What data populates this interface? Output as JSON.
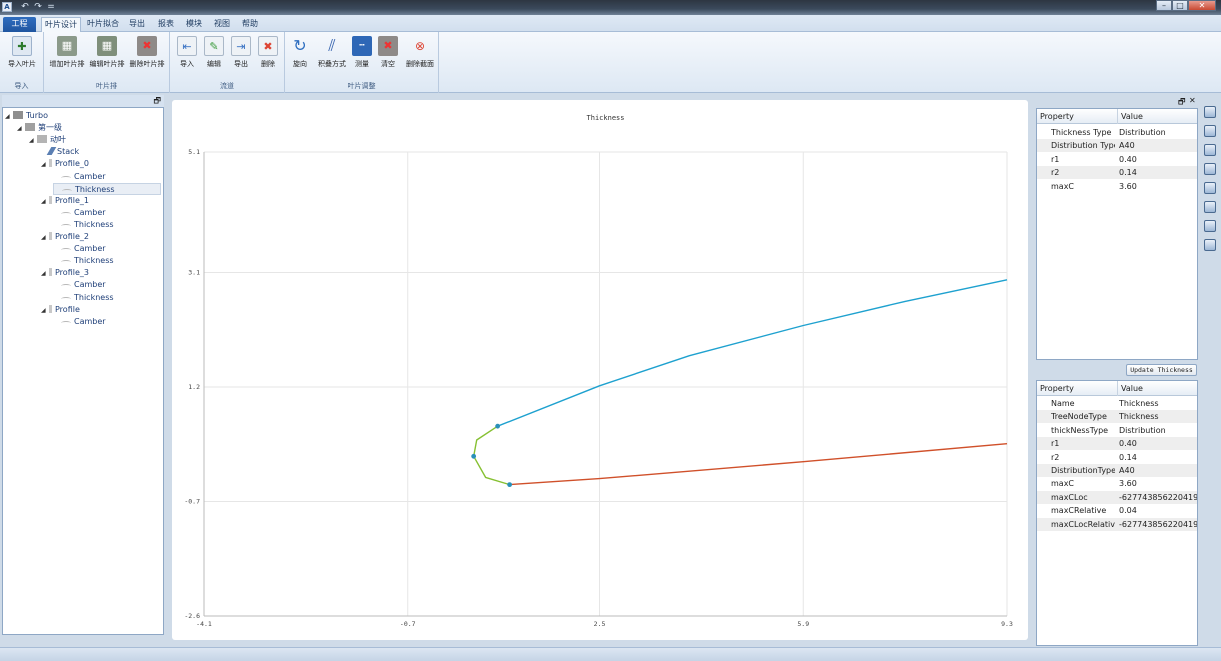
{
  "title_bar": {
    "app_icon": "A",
    "undo_icon": "↶",
    "redo_icon": "↷",
    "more_icon": "=",
    "min_icon": "–",
    "max_icon": "□",
    "close_icon": "✕"
  },
  "tabs": [
    "工程",
    "叶片设计",
    "叶片拟合",
    "导出",
    "报表",
    "模块",
    "视图",
    "帮助"
  ],
  "ribbon": {
    "groups": [
      {
        "label": "导入",
        "buttons": [
          "导入叶片"
        ]
      },
      {
        "label": "叶片排",
        "buttons": [
          "增加叶片排",
          "编辑叶片排",
          "删除叶片排"
        ]
      },
      {
        "label": "流道",
        "buttons": [
          "导入",
          "编辑",
          "导出",
          "删除"
        ]
      },
      {
        "label": "叶片调整",
        "buttons": [
          "旋向",
          "积叠方式",
          "测量",
          "清空",
          "删除截面"
        ]
      }
    ]
  },
  "tree": {
    "panel_icon": "🗗",
    "nodes": [
      {
        "label": "Turbo",
        "toggle": "◢"
      },
      {
        "label": "第一级",
        "toggle": "◢"
      },
      {
        "label": "动叶",
        "toggle": "◢"
      },
      {
        "label": "Stack",
        "toggle": ""
      },
      {
        "label": "Profile_0",
        "toggle": "◢"
      },
      {
        "label": "Camber",
        "toggle": ""
      },
      {
        "label": "Thickness",
        "toggle": ""
      },
      {
        "label": "Profile_1",
        "toggle": "◢"
      },
      {
        "label": "Camber",
        "toggle": ""
      },
      {
        "label": "Thickness",
        "toggle": ""
      },
      {
        "label": "Profile_2",
        "toggle": "◢"
      },
      {
        "label": "Camber",
        "toggle": ""
      },
      {
        "label": "Thickness",
        "toggle": ""
      },
      {
        "label": "Profile_3",
        "toggle": "◢"
      },
      {
        "label": "Camber",
        "toggle": ""
      },
      {
        "label": "Thickness",
        "toggle": ""
      },
      {
        "label": "Profile",
        "toggle": "◢"
      },
      {
        "label": "Camber",
        "toggle": ""
      }
    ]
  },
  "chart_data": {
    "type": "line",
    "title": "Thickness",
    "xlim": [
      -4.1,
      9.3
    ],
    "ylim": [
      -2.6,
      5.1
    ],
    "x_ticks": [
      "-4.1",
      "-0.7",
      "2.5",
      "5.9",
      "9.3"
    ],
    "y_ticks": [
      "5.1",
      "3.1",
      "1.2",
      "-0.7",
      "-2.6"
    ],
    "grid": true,
    "series": [
      {
        "color": "#1ea1cf",
        "points": [
          [
            0.8,
            0.55
          ],
          [
            2.5,
            1.22
          ],
          [
            4.0,
            1.72
          ],
          [
            5.9,
            2.22
          ],
          [
            7.6,
            2.62
          ],
          [
            9.3,
            2.98
          ]
        ]
      },
      {
        "color": "#d0502a",
        "points": [
          [
            1.0,
            -0.42
          ],
          [
            2.5,
            -0.32
          ],
          [
            5.9,
            -0.04
          ],
          [
            9.3,
            0.26
          ]
        ]
      },
      {
        "color": "#86c032",
        "points": [
          [
            0.8,
            0.55
          ],
          [
            0.45,
            0.32
          ],
          [
            0.4,
            0.05
          ],
          [
            0.6,
            -0.3
          ],
          [
            1.0,
            -0.42
          ]
        ]
      }
    ],
    "markers": [
      [
        0.8,
        0.55
      ],
      [
        0.4,
        0.05
      ],
      [
        1.0,
        -0.42
      ]
    ]
  },
  "props_top": {
    "header": [
      "Property",
      "Value"
    ],
    "rows": [
      [
        "Thickness Type",
        "Distribution"
      ],
      [
        "Distribution Type",
        "A40"
      ],
      [
        "r1",
        "0.40"
      ],
      [
        "r2",
        "0.14"
      ],
      [
        "maxC",
        "3.60"
      ]
    ]
  },
  "update_button": "Update Thickness",
  "props_bottom": {
    "header": [
      "Property",
      "Value"
    ],
    "rows": [
      [
        "Name",
        "Thickness"
      ],
      [
        "TreeNodeType",
        "Thickness"
      ],
      [
        "thickNessType",
        "Distribution"
      ],
      [
        "r1",
        "0.40"
      ],
      [
        "r2",
        "0.14"
      ],
      [
        "DistributionType",
        "A40"
      ],
      [
        "maxC",
        "3.60"
      ],
      [
        "maxCLoc",
        "-627743856220419..."
      ],
      [
        "maxCRelative",
        "0.04"
      ],
      [
        "maxCLocRelative",
        "-627743856220419..."
      ]
    ]
  },
  "dock_controls": {
    "pin": "🗗",
    "close": "✕"
  }
}
